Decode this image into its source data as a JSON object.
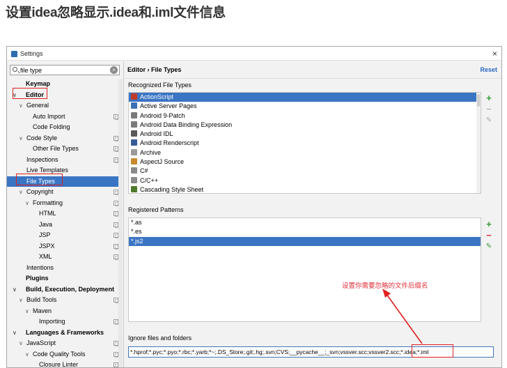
{
  "heading": "设置idea忽略显示.idea和.iml文件信息",
  "window": {
    "title": "Settings",
    "close": "×"
  },
  "search": {
    "value": "file type"
  },
  "tree": [
    {
      "label": "Keymap",
      "level": 0,
      "bold": true
    },
    {
      "label": "Editor",
      "level": 0,
      "bold": true,
      "expanded": true
    },
    {
      "label": "General",
      "level": 1,
      "expanded": true
    },
    {
      "label": "Auto Import",
      "level": 2,
      "copy": true
    },
    {
      "label": "Code Folding",
      "level": 2
    },
    {
      "label": "Code Style",
      "level": 1,
      "expanded": true,
      "copy": true
    },
    {
      "label": "Other File Types",
      "level": 2,
      "copy": true
    },
    {
      "label": "Inspections",
      "level": 1,
      "copy": true
    },
    {
      "label": "Live Templates",
      "level": 1
    },
    {
      "label": "File Types",
      "level": 1,
      "selected": true
    },
    {
      "label": "Copyright",
      "level": 1,
      "expanded": true,
      "copy": true
    },
    {
      "label": "Formatting",
      "level": 2,
      "expanded": true,
      "copy": true
    },
    {
      "label": "HTML",
      "level": 3,
      "copy": true
    },
    {
      "label": "Java",
      "level": 3,
      "copy": true
    },
    {
      "label": "JSP",
      "level": 3,
      "copy": true
    },
    {
      "label": "JSPX",
      "level": 3,
      "copy": true
    },
    {
      "label": "XML",
      "level": 3,
      "copy": true
    },
    {
      "label": "Intentions",
      "level": 1
    },
    {
      "label": "Plugins",
      "level": 0,
      "bold": true
    },
    {
      "label": "Build, Execution, Deployment",
      "level": 0,
      "bold": true,
      "expanded": true
    },
    {
      "label": "Build Tools",
      "level": 1,
      "expanded": true,
      "copy": true
    },
    {
      "label": "Maven",
      "level": 2,
      "expanded": true
    },
    {
      "label": "Importing",
      "level": 3,
      "copy": true
    },
    {
      "label": "Languages & Frameworks",
      "level": 0,
      "bold": true,
      "expanded": true
    },
    {
      "label": "JavaScript",
      "level": 1,
      "expanded": true,
      "copy": true
    },
    {
      "label": "Code Quality Tools",
      "level": 2,
      "expanded": true,
      "copy": true
    },
    {
      "label": "Closure Linter",
      "level": 3,
      "copy": true
    }
  ],
  "breadcrumb": "Editor › File Types",
  "reset": "Reset",
  "recognized": {
    "label": "Recognized File Types",
    "items": [
      {
        "name": "ActionScript",
        "color": "#c0392b",
        "selected": true
      },
      {
        "name": "Active Server Pages",
        "color": "#3a6fb5"
      },
      {
        "name": "Android 9-Patch",
        "color": "#7a7a7a"
      },
      {
        "name": "Android Data Binding Expression",
        "color": "#7a7a7a"
      },
      {
        "name": "Android IDL",
        "color": "#5b5b5b"
      },
      {
        "name": "Android Renderscript",
        "color": "#355c9a"
      },
      {
        "name": "Archive",
        "color": "#9a9a9a"
      },
      {
        "name": "AspectJ Source",
        "color": "#c98a2c"
      },
      {
        "name": "C#",
        "color": "#8a8a8a"
      },
      {
        "name": "C/C++",
        "color": "#8a8a8a"
      },
      {
        "name": "Cascading Style Sheet",
        "color": "#4f7a2a"
      }
    ]
  },
  "patterns": {
    "label": "Registered Patterns",
    "items": [
      {
        "name": "*.as"
      },
      {
        "name": "*.es"
      },
      {
        "name": "*.js2",
        "selected": true
      }
    ]
  },
  "ignore": {
    "label": "Ignore files and folders",
    "value": "*.hprof;*.pyc;*.pyo;*.rbc;*.yarb;*~;.DS_Store;.git;.hg;.svn;CVS;__pycache__;_svn;vssver.scc;vssver2.scc;*.idea;*.iml"
  },
  "annotation": "设置你需要忽略的文件后缀名",
  "colors": {
    "selection": "#3a75c4",
    "accent": "#2a67c0",
    "annotation": "#e0303a"
  }
}
